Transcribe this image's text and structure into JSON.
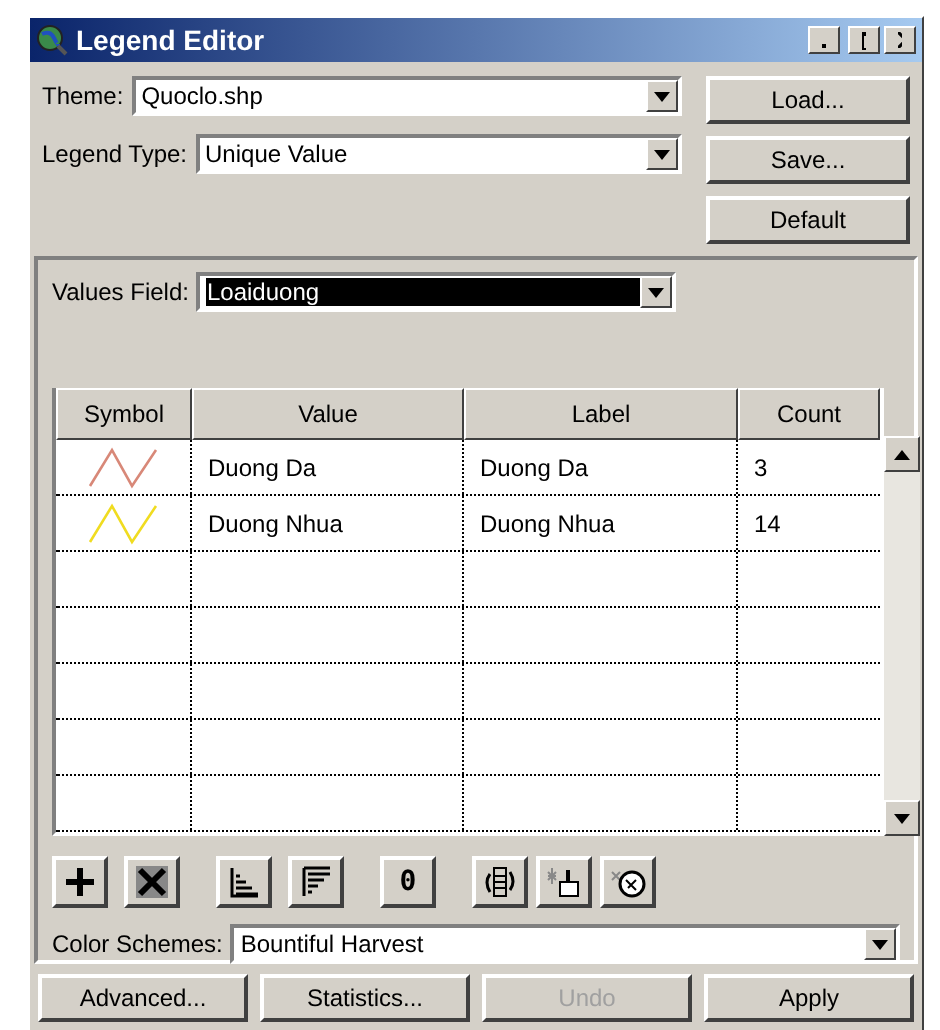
{
  "window": {
    "title": "Legend Editor"
  },
  "theme": {
    "label": "Theme:",
    "value": "Quoclo.shp"
  },
  "legend_type": {
    "label": "Legend Type:",
    "value": "Unique Value"
  },
  "side_buttons": [
    "Load...",
    "Save...",
    "Default"
  ],
  "values_field": {
    "label": "Values Field:",
    "value": "Loaiduong",
    "focused": true
  },
  "table": {
    "columns": [
      "Symbol",
      "Value",
      "Label",
      "Count"
    ],
    "rows": [
      {
        "color": "#d88878",
        "value": "Duong Da",
        "label": "Duong Da",
        "count": "3"
      },
      {
        "color": "#f0dc20",
        "value": "Duong Nhua",
        "label": "Duong Nhua",
        "count": "14"
      }
    ]
  },
  "toolbar": [
    {
      "kind": "add"
    },
    {
      "kind": "delete"
    },
    {
      "kind": "sort-asc"
    },
    {
      "kind": "sort-desc"
    },
    {
      "kind": "text",
      "text": "0"
    },
    {
      "kind": "flip"
    },
    {
      "kind": "clear"
    },
    {
      "kind": "reset"
    }
  ],
  "color_schemes": {
    "label": "Color Schemes:",
    "value": "Bountiful Harvest"
  },
  "bottom_buttons": [
    {
      "label": "Advanced...",
      "disabled": false
    },
    {
      "label": "Statistics...",
      "disabled": false
    },
    {
      "label": "Undo",
      "disabled": true
    },
    {
      "label": "Apply",
      "disabled": false
    }
  ]
}
